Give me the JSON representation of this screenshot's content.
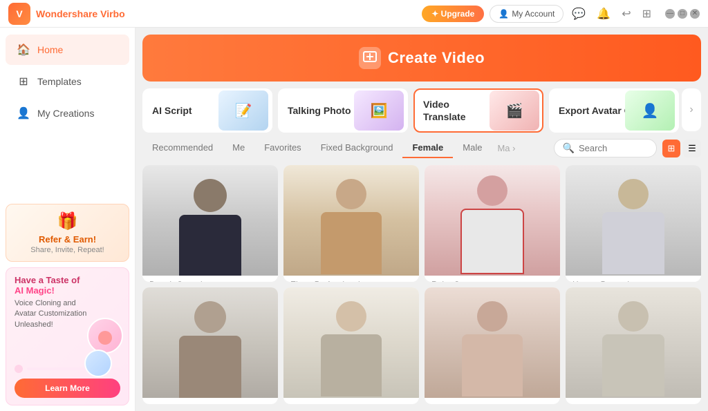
{
  "app": {
    "name_prefix": "Wondershare",
    "name_suffix": "Virbo"
  },
  "titlebar": {
    "upgrade_label": "✦ Upgrade",
    "account_label": "My Account",
    "icons": [
      "💬",
      "🔔",
      "↩",
      "⋮⋮"
    ]
  },
  "sidebar": {
    "items": [
      {
        "id": "home",
        "label": "Home",
        "icon": "🏠",
        "active": true
      },
      {
        "id": "templates",
        "label": "Templates",
        "icon": "⊞"
      },
      {
        "id": "my-creations",
        "label": "My Creations",
        "icon": "👤"
      }
    ],
    "promo_refer": {
      "title": "Refer & Earn!",
      "subtitle": "Share, Invite, Repeat!"
    },
    "promo_ai": {
      "title": "Have a Taste of",
      "title2": "AI Magic!",
      "subtitle": "Voice Cloning and\nAvatar Customization Unleashed!",
      "learn_more": "Learn More"
    }
  },
  "hero": {
    "icon": "＋",
    "title": "Create Video"
  },
  "feature_cards": [
    {
      "id": "ai-script",
      "label": "AI Script",
      "active": false
    },
    {
      "id": "talking-photo",
      "label": "Talking Photo",
      "active": false
    },
    {
      "id": "video-translate",
      "label": "Video\nTranslate",
      "active": true
    },
    {
      "id": "export-avatar",
      "label": "Export Avatar Only",
      "active": false
    }
  ],
  "filter_tabs": [
    {
      "id": "recommended",
      "label": "Recommended",
      "active": false
    },
    {
      "id": "me",
      "label": "Me",
      "active": false
    },
    {
      "id": "favorites",
      "label": "Favorites",
      "active": false
    },
    {
      "id": "fixed-bg",
      "label": "Fixed Background",
      "active": false
    },
    {
      "id": "female",
      "label": "Female",
      "active": true
    },
    {
      "id": "male",
      "label": "Male",
      "active": false
    },
    {
      "id": "more",
      "label": "Ma",
      "active": false
    }
  ],
  "search": {
    "placeholder": "Search"
  },
  "avatars_row1": [
    {
      "id": "brandt",
      "name": "Brandt-Casual",
      "bg": "brandt"
    },
    {
      "id": "elena",
      "name": "Elena-Professional",
      "bg": "elena"
    },
    {
      "id": "ruby",
      "name": "Ruby-Games",
      "bg": "ruby"
    },
    {
      "id": "harper",
      "name": "Harper-Promotion",
      "bg": "harper"
    }
  ],
  "avatars_row2": [
    {
      "id": "m1",
      "name": "",
      "bg": "m1"
    },
    {
      "id": "f2",
      "name": "",
      "bg": "f2"
    },
    {
      "id": "f3",
      "name": "",
      "bg": "f3"
    },
    {
      "id": "f4",
      "name": "",
      "bg": "f4"
    }
  ]
}
